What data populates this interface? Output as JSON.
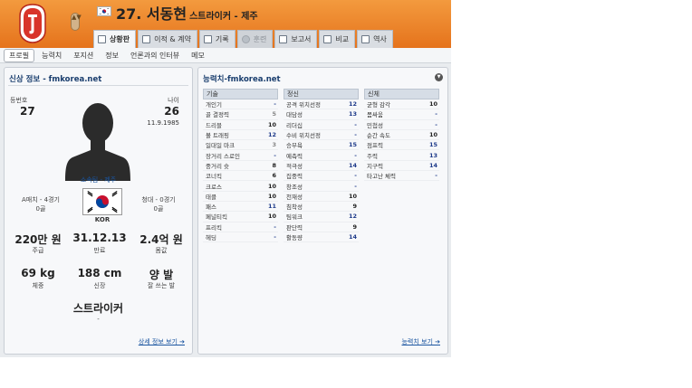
{
  "header": {
    "player_number_name": "27. 서동현",
    "player_subtitle": "스트라이커 - 제주",
    "nav_arrows": "▲▼",
    "colors": {
      "header_orange": "#e5731c",
      "link_blue": "#1a55a0",
      "title_navy": "#1a3e6e"
    }
  },
  "tabs": [
    {
      "label": "상황판",
      "icon": "player-icon",
      "active": true
    },
    {
      "label": "이적 & 계약",
      "icon": "contract-icon"
    },
    {
      "label": "기록",
      "icon": "chart-icon"
    },
    {
      "label": "훈련",
      "icon": "cloud-icon",
      "disabled": true
    },
    {
      "label": "보고서",
      "icon": "report-icon"
    },
    {
      "label": "비교",
      "icon": "compare-icon"
    },
    {
      "label": "역사",
      "icon": "history-icon"
    }
  ],
  "subtabs": [
    "프로필",
    "능력치",
    "포지션",
    "정보",
    "언론과의 인터뷰",
    "메모"
  ],
  "profile": {
    "title": "신상 정보 - fmkorea.net",
    "number_label": "등번호",
    "number_value": "27",
    "age_label": "나이",
    "age_value": "26",
    "birthdate": "11.9.1985",
    "club_link": "소속팀 - 제주",
    "a_caps_label": "A매치 - 4경기",
    "a_goals": "0골",
    "youth_caps_label": "청대 - 0경기",
    "youth_goals": "0골",
    "nation_code": "KOR",
    "wage_value": "220만 원",
    "wage_label": "주급",
    "contract_value": "31.12.13",
    "contract_label": "만료",
    "value_value": "2.4억 원",
    "value_label": "몸값",
    "weight_value": "69 kg",
    "weight_label": "체중",
    "height_value": "188 cm",
    "height_label": "신장",
    "foot_value": "양 발",
    "foot_label": "잘 쓰는 발",
    "position": "스트라이커",
    "position_sub": "-",
    "detail_link": "상세 정보 보기 ➔"
  },
  "attributes": {
    "title": "능력치-fmkorea.net",
    "more_link": "능력치 보기 ➔",
    "columns": [
      {
        "header": "기술",
        "rows": [
          {
            "name": "개인기",
            "value": "-"
          },
          {
            "name": "골 결정력",
            "value": "5"
          },
          {
            "name": "드리블",
            "value": "10"
          },
          {
            "name": "볼 트래핑",
            "value": "12"
          },
          {
            "name": "일대일 마크",
            "value": "3"
          },
          {
            "name": "장거리 스로인",
            "value": "-"
          },
          {
            "name": "중거리 슛",
            "value": "8"
          },
          {
            "name": "코너킥",
            "value": "6"
          },
          {
            "name": "크로스",
            "value": "10"
          },
          {
            "name": "태클",
            "value": "10"
          },
          {
            "name": "패스",
            "value": "11"
          },
          {
            "name": "페널티킥",
            "value": "10"
          },
          {
            "name": "프리킥",
            "value": "-"
          },
          {
            "name": "헤딩",
            "value": "-"
          }
        ]
      },
      {
        "header": "정신",
        "rows": [
          {
            "name": "공격 위치선정",
            "value": "12"
          },
          {
            "name": "대담성",
            "value": "13"
          },
          {
            "name": "리더십",
            "value": "-"
          },
          {
            "name": "수비 위치선정",
            "value": "-"
          },
          {
            "name": "승부욕",
            "value": "15"
          },
          {
            "name": "예측력",
            "value": "-"
          },
          {
            "name": "적극성",
            "value": "14"
          },
          {
            "name": "집중력",
            "value": "-"
          },
          {
            "name": "창조성",
            "value": "-"
          },
          {
            "name": "천재성",
            "value": "10"
          },
          {
            "name": "침착성",
            "value": "9"
          },
          {
            "name": "팀워크",
            "value": "12"
          },
          {
            "name": "판단력",
            "value": "9"
          },
          {
            "name": "활동량",
            "value": "14"
          }
        ]
      },
      {
        "header": "신체",
        "rows": [
          {
            "name": "균형 감각",
            "value": "10"
          },
          {
            "name": "몸싸움",
            "value": "-"
          },
          {
            "name": "민첩성",
            "value": "-"
          },
          {
            "name": "순간 속도",
            "value": "10"
          },
          {
            "name": "점프력",
            "value": "15"
          },
          {
            "name": "주력",
            "value": "13"
          },
          {
            "name": "지구력",
            "value": "14"
          },
          {
            "name": "타고난 체력",
            "value": "-"
          }
        ]
      }
    ]
  }
}
